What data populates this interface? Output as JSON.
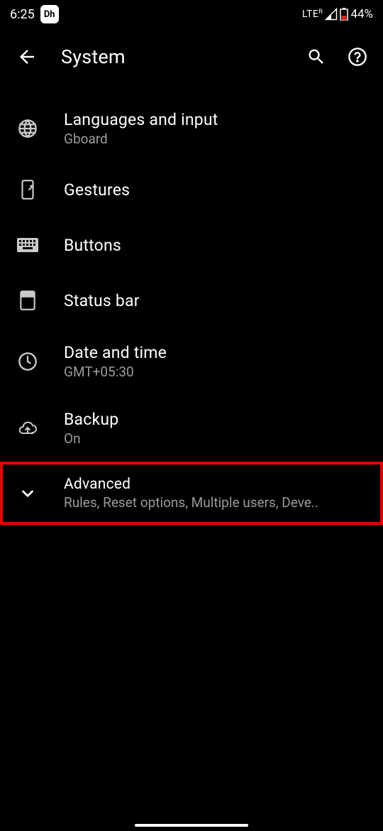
{
  "status": {
    "time": "6:25",
    "app_badge": "Dh",
    "network": "LTE",
    "network_sup": "R",
    "battery_pct": "44%"
  },
  "header": {
    "title": "System"
  },
  "items": {
    "languages": {
      "title": "Languages and input",
      "subtitle": "Gboard"
    },
    "gestures": {
      "title": "Gestures"
    },
    "buttons": {
      "title": "Buttons"
    },
    "statusbar": {
      "title": "Status bar"
    },
    "datetime": {
      "title": "Date and time",
      "subtitle": "GMT+05:30"
    },
    "backup": {
      "title": "Backup",
      "subtitle": "On"
    },
    "advanced": {
      "title": "Advanced",
      "subtitle": "Rules, Reset options, Multiple users, Deve.."
    }
  }
}
